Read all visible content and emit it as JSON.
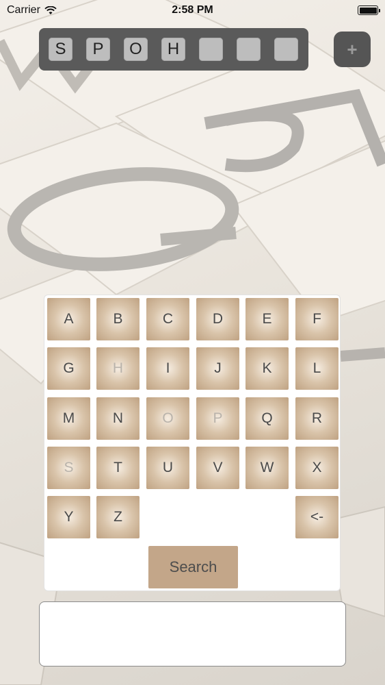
{
  "status_bar": {
    "carrier": "Carrier",
    "time": "2:58 PM"
  },
  "slots": [
    "S",
    "P",
    "O",
    "H",
    "",
    "",
    ""
  ],
  "add_button": {
    "label": "+"
  },
  "keyboard": {
    "keys": [
      {
        "label": "A",
        "disabled": false
      },
      {
        "label": "B",
        "disabled": false
      },
      {
        "label": "C",
        "disabled": false
      },
      {
        "label": "D",
        "disabled": false
      },
      {
        "label": "E",
        "disabled": false
      },
      {
        "label": "F",
        "disabled": false
      },
      {
        "label": "G",
        "disabled": false
      },
      {
        "label": "H",
        "disabled": true
      },
      {
        "label": "I",
        "disabled": false
      },
      {
        "label": "J",
        "disabled": false
      },
      {
        "label": "K",
        "disabled": false
      },
      {
        "label": "L",
        "disabled": false
      },
      {
        "label": "M",
        "disabled": false
      },
      {
        "label": "N",
        "disabled": false
      },
      {
        "label": "O",
        "disabled": true
      },
      {
        "label": "P",
        "disabled": true
      },
      {
        "label": "Q",
        "disabled": false
      },
      {
        "label": "R",
        "disabled": false
      },
      {
        "label": "S",
        "disabled": true
      },
      {
        "label": "T",
        "disabled": false
      },
      {
        "label": "U",
        "disabled": false
      },
      {
        "label": "V",
        "disabled": false
      },
      {
        "label": "W",
        "disabled": false
      },
      {
        "label": "X",
        "disabled": false
      },
      {
        "label": "Y",
        "disabled": false
      },
      {
        "label": "Z",
        "disabled": false
      }
    ],
    "backspace_label": "<-",
    "search_label": "Search"
  },
  "results": {
    "text": ""
  },
  "icons": {
    "signal": "wifi-icon",
    "battery": "battery-icon"
  },
  "colors": {
    "slot_panel": "#5a5a5a",
    "key_tan": "#c3a689",
    "disabled_key_text": "#b9b3ab"
  }
}
